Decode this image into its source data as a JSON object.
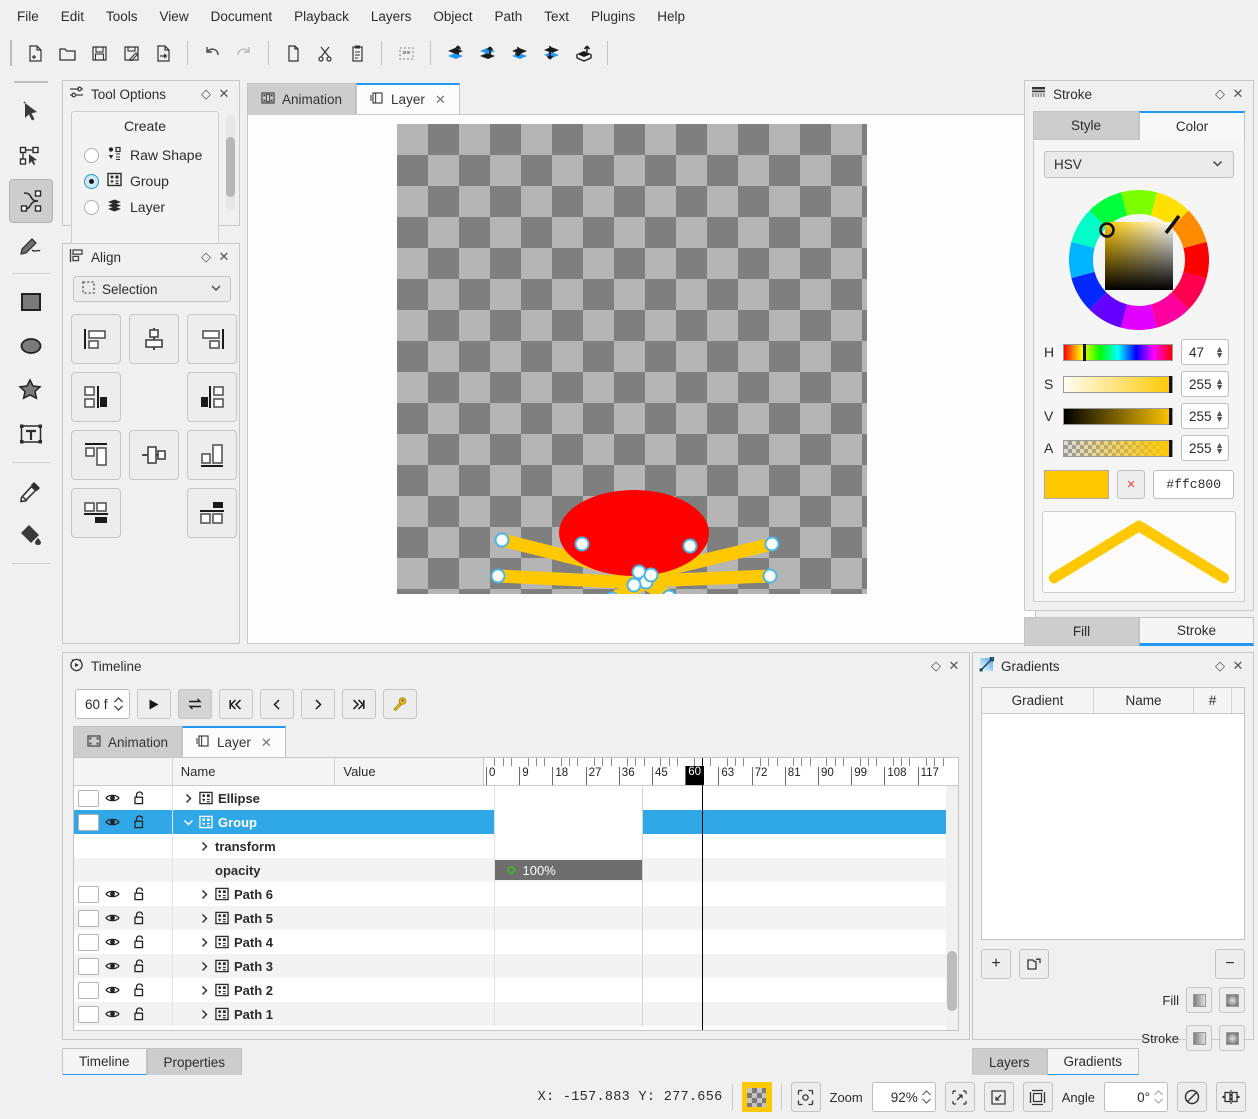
{
  "menubar": {
    "items": [
      "File",
      "Edit",
      "Tools",
      "View",
      "Document",
      "Playback",
      "Layers",
      "Object",
      "Path",
      "Text",
      "Plugins",
      "Help"
    ]
  },
  "toolbar": {
    "buttons": [
      {
        "name": "new-document",
        "icon": "file-new-icon"
      },
      {
        "name": "open-document",
        "icon": "folder-open-icon"
      },
      {
        "name": "save-document",
        "icon": "floppy-save-icon"
      },
      {
        "name": "save-as",
        "icon": "floppy-edit-icon"
      },
      {
        "name": "export",
        "icon": "file-export-icon"
      },
      {
        "name": "undo",
        "icon": "undo-arrow-icon"
      },
      {
        "name": "redo",
        "icon": "redo-arrow-icon"
      },
      {
        "name": "copy",
        "icon": "copy-icon"
      },
      {
        "name": "cut",
        "icon": "scissors-icon"
      },
      {
        "name": "paste",
        "icon": "clipboard-icon"
      },
      {
        "name": "group-select",
        "icon": "dashed-box-icon"
      },
      {
        "name": "raise-to-top",
        "icon": "raise-top-icon"
      },
      {
        "name": "raise",
        "icon": "raise-icon"
      },
      {
        "name": "lower",
        "icon": "lower-icon"
      },
      {
        "name": "lower-to-bottom",
        "icon": "lower-bottom-icon"
      },
      {
        "name": "move-layer",
        "icon": "move-layer-icon"
      }
    ]
  },
  "toolrail": {
    "tools": [
      {
        "name": "select-tool",
        "icon": "cursor-arrow-icon",
        "active": false
      },
      {
        "name": "edit-nodes-tool",
        "icon": "node-edit-icon",
        "active": false
      },
      {
        "name": "draw-path-tool",
        "icon": "bezier-path-icon",
        "active": true
      },
      {
        "name": "freehand-tool",
        "icon": "pencil-stroke-icon",
        "active": false
      },
      {
        "name": "rectangle-tool",
        "icon": "square-icon",
        "active": false
      },
      {
        "name": "ellipse-tool",
        "icon": "ellipse-icon",
        "active": false
      },
      {
        "name": "star-tool",
        "icon": "star-icon",
        "active": false
      },
      {
        "name": "text-tool",
        "icon": "text-box-icon",
        "active": false
      },
      {
        "name": "eyedropper-tool",
        "icon": "eyedropper-icon",
        "active": false
      },
      {
        "name": "fill-tool",
        "icon": "paint-bucket-icon",
        "active": false
      }
    ]
  },
  "tool_options": {
    "title": "Tool Options",
    "group_header": "Create",
    "options": [
      {
        "label": "Raw Shape",
        "icon": "raw-shape-icon",
        "selected": false
      },
      {
        "label": "Group",
        "icon": "group-icon",
        "selected": true
      },
      {
        "label": "Layer",
        "icon": "layer-stack-icon",
        "selected": false
      }
    ]
  },
  "align": {
    "title": "Align",
    "target_label": "Selection",
    "buttons": [
      {
        "name": "align-left-edges",
        "icon": "align-left-icon"
      },
      {
        "name": "align-horizontal-center",
        "icon": "align-hcenter-icon"
      },
      {
        "name": "align-right-edges",
        "icon": "align-right-icon"
      },
      {
        "name": "align-left-to-anchor",
        "icon": "align-left-anchor-icon"
      },
      {
        "name": "spacer",
        "icon": "none"
      },
      {
        "name": "align-right-to-anchor",
        "icon": "align-right-anchor-icon"
      },
      {
        "name": "align-top-edges",
        "icon": "align-top-icon"
      },
      {
        "name": "align-vertical-center",
        "icon": "align-vcenter-icon"
      },
      {
        "name": "align-bottom-edges",
        "icon": "align-bottom-icon"
      },
      {
        "name": "align-top-to-anchor",
        "icon": "align-top-anchor-icon"
      },
      {
        "name": "spacer",
        "icon": "none"
      },
      {
        "name": "align-bottom-to-anchor",
        "icon": "align-bottom-anchor-icon"
      }
    ]
  },
  "canvas": {
    "tabs": [
      {
        "label": "Animation",
        "icon": "film-icon",
        "active": false,
        "closable": false
      },
      {
        "label": "Layer",
        "icon": "layer-tab-icon",
        "active": true,
        "closable": true
      }
    ],
    "artwork": {
      "body_color": "#ff0000",
      "leg_color": "#ffc800",
      "node_color": "#ffffff",
      "node_outline": "#2196f3"
    }
  },
  "stroke_panel": {
    "title": "Stroke",
    "tabs": [
      {
        "label": "Style",
        "active": false
      },
      {
        "label": "Color",
        "active": true
      }
    ],
    "color_mode": "HSV",
    "channels": [
      {
        "label": "H",
        "value": "47",
        "pos": 0.184
      },
      {
        "label": "S",
        "value": "255",
        "pos": 1.0
      },
      {
        "label": "V",
        "value": "255",
        "pos": 1.0
      },
      {
        "label": "A",
        "value": "255",
        "pos": 1.0
      }
    ],
    "hex": "#ffc800",
    "swatch_color": "#ffc800",
    "clear_label": "×",
    "footer_tabs": [
      {
        "label": "Fill",
        "active": false
      },
      {
        "label": "Stroke",
        "active": true
      }
    ]
  },
  "timeline": {
    "title": "Timeline",
    "frame_count": "60 f",
    "controls": [
      {
        "name": "play-button",
        "icon": "play-icon",
        "active": false
      },
      {
        "name": "loop-button",
        "icon": "loop-icon",
        "active": true
      },
      {
        "name": "go-to-start-button",
        "icon": "skip-start-icon",
        "active": false
      },
      {
        "name": "previous-frame-button",
        "icon": "chevron-left-icon",
        "active": false
      },
      {
        "name": "next-frame-button",
        "icon": "chevron-right-icon",
        "active": false
      },
      {
        "name": "go-to-end-button",
        "icon": "skip-end-icon",
        "active": false
      },
      {
        "name": "add-keyframe-button",
        "icon": "key-icon",
        "active": false
      }
    ],
    "tabs": [
      {
        "label": "Animation",
        "icon": "film-icon",
        "active": false,
        "closable": false
      },
      {
        "label": "Layer",
        "icon": "layer-tab-icon",
        "active": true,
        "closable": true
      }
    ],
    "columns": [
      "Name",
      "Value"
    ],
    "rows": [
      {
        "name": "Ellipse",
        "icon": "group-icon",
        "indent": 0,
        "expander": "collapsed",
        "selected": false,
        "has_controls": true,
        "value": null,
        "alt": false
      },
      {
        "name": "Group",
        "icon": "group-icon",
        "indent": 0,
        "expander": "expanded",
        "selected": true,
        "has_controls": true,
        "value": null,
        "alt": false
      },
      {
        "name": "transform",
        "icon": null,
        "indent": 1,
        "expander": "collapsed",
        "selected": false,
        "has_controls": false,
        "value": null,
        "alt": false
      },
      {
        "name": "opacity",
        "icon": null,
        "indent": 1,
        "expander": "none",
        "selected": false,
        "has_controls": false,
        "value": "100%",
        "alt": true
      },
      {
        "name": "Path 6",
        "icon": "group-icon",
        "indent": 1,
        "expander": "collapsed",
        "selected": false,
        "has_controls": true,
        "value": null,
        "alt": false
      },
      {
        "name": "Path 5",
        "icon": "group-icon",
        "indent": 1,
        "expander": "collapsed",
        "selected": false,
        "has_controls": true,
        "value": null,
        "alt": true
      },
      {
        "name": "Path 4",
        "icon": "group-icon",
        "indent": 1,
        "expander": "collapsed",
        "selected": false,
        "has_controls": true,
        "value": null,
        "alt": false
      },
      {
        "name": "Path 3",
        "icon": "group-icon",
        "indent": 1,
        "expander": "collapsed",
        "selected": false,
        "has_controls": true,
        "value": null,
        "alt": true
      },
      {
        "name": "Path 2",
        "icon": "group-icon",
        "indent": 1,
        "expander": "collapsed",
        "selected": false,
        "has_controls": true,
        "value": null,
        "alt": false
      },
      {
        "name": "Path 1",
        "icon": "group-icon",
        "indent": 1,
        "expander": "collapsed",
        "selected": false,
        "has_controls": true,
        "value": null,
        "alt": true
      }
    ],
    "ruler_ticks": [
      "0",
      "9",
      "18",
      "27",
      "36",
      "45",
      "60",
      "63",
      "72",
      "81",
      "90",
      "99",
      "108",
      "117"
    ],
    "current_frame": "60"
  },
  "gradients": {
    "title": "Gradients",
    "columns": [
      "Gradient",
      "Name",
      "#"
    ],
    "rows": [],
    "add_label": "+",
    "remove_label": "−",
    "fill_label": "Fill",
    "stroke_label": "Stroke"
  },
  "bottom_tabs_left": [
    {
      "label": "Timeline",
      "active": true
    },
    {
      "label": "Properties",
      "active": false
    }
  ],
  "bottom_tabs_right": [
    {
      "label": "Layers",
      "active": false
    },
    {
      "label": "Gradients",
      "active": true
    }
  ],
  "statusbar": {
    "coords": "X:  -157.883 Y:   277.656",
    "color_swatch": "#ffc800",
    "zoom_label": "Zoom",
    "zoom_value": "92%",
    "angle_label": "Angle",
    "angle_value": "0°"
  }
}
